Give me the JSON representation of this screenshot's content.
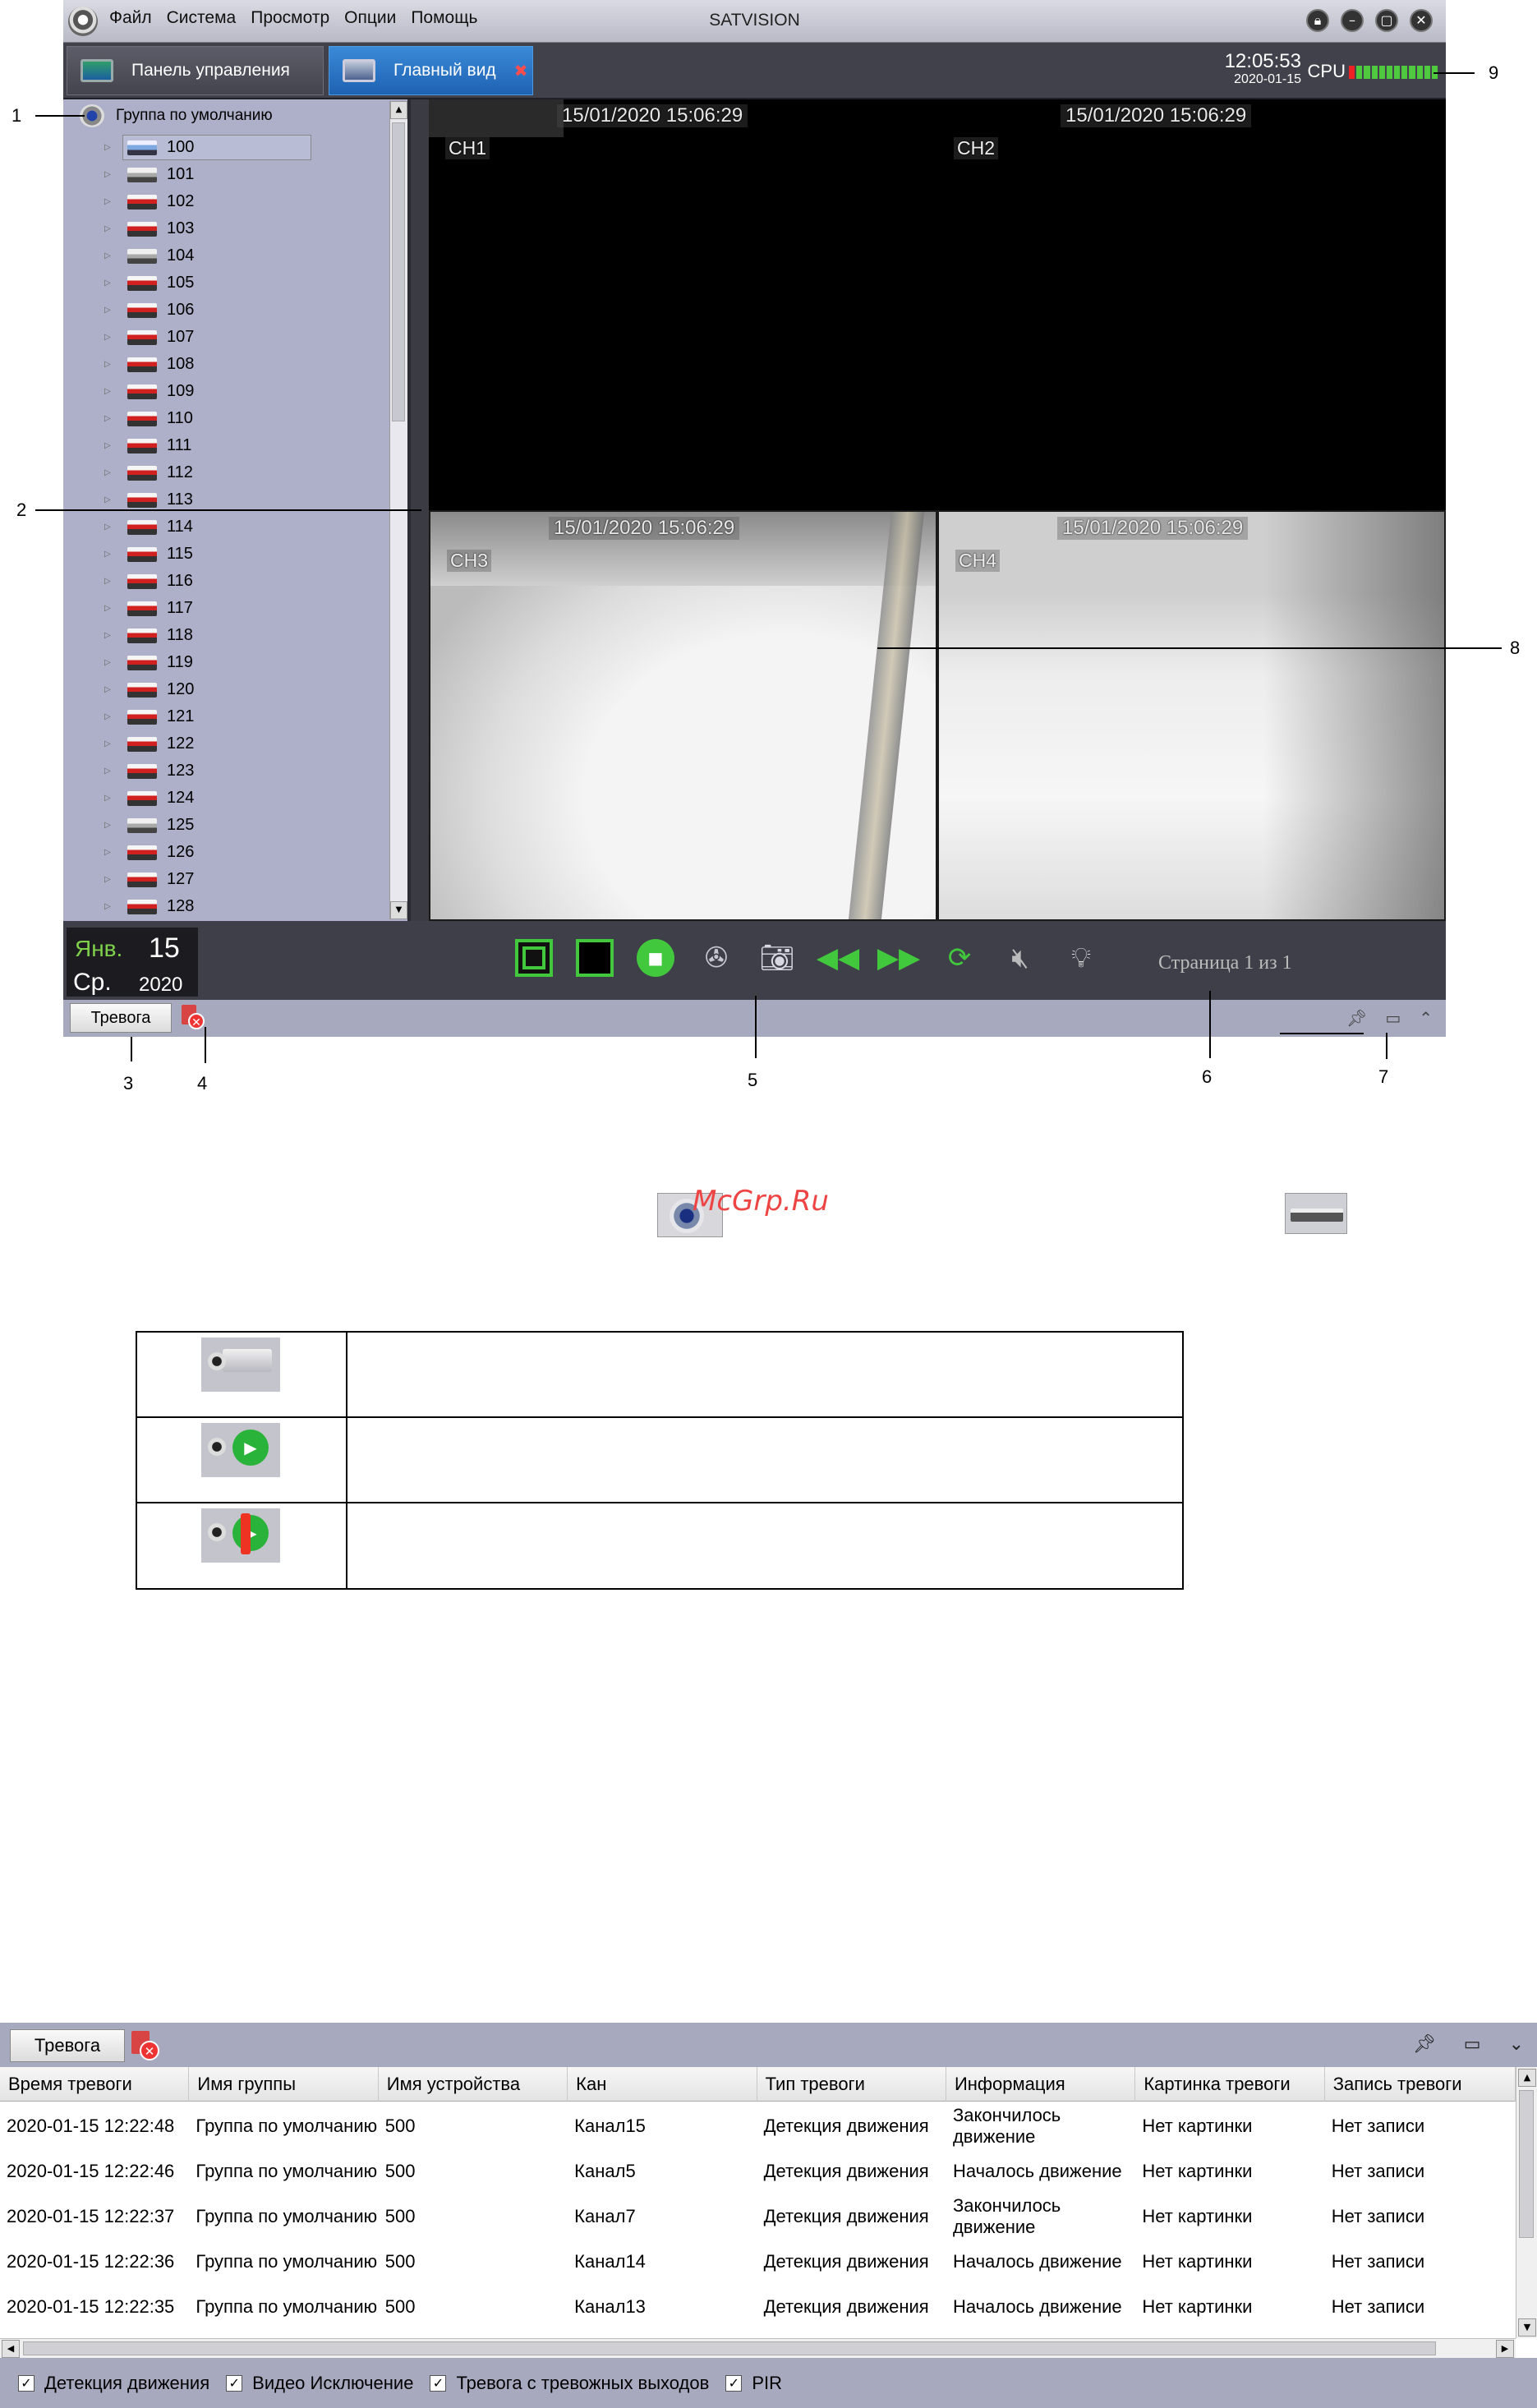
{
  "app": {
    "title": "SATVISION",
    "menu": [
      "Файл",
      "Система",
      "Просмотр",
      "Опции",
      "Помощь"
    ],
    "window_controls": [
      "lock-icon",
      "minimize-icon",
      "maximize-icon",
      "close-icon"
    ]
  },
  "tabs": {
    "dashboard": "Панель управления",
    "main_view": "Главный вид",
    "close_glyph": "✖"
  },
  "status": {
    "time": "12:05:53",
    "date": "2020-01-15",
    "cpu_label": "CPU",
    "cpu_load_fraction": 0.1
  },
  "tree": {
    "group": "Группа по умолчанию",
    "items": [
      {
        "label": "100",
        "state": "online"
      },
      {
        "label": "101",
        "state": "plain"
      },
      {
        "label": "102",
        "state": "ok"
      },
      {
        "label": "103",
        "state": "ok"
      },
      {
        "label": "104",
        "state": "plain"
      },
      {
        "label": "105",
        "state": "ok"
      },
      {
        "label": "106",
        "state": "ok"
      },
      {
        "label": "107",
        "state": "ok"
      },
      {
        "label": "108",
        "state": "ok"
      },
      {
        "label": "109",
        "state": "ok"
      },
      {
        "label": "110",
        "state": "ok"
      },
      {
        "label": "111",
        "state": "ok"
      },
      {
        "label": "112",
        "state": "ok"
      },
      {
        "label": "113",
        "state": "ok"
      },
      {
        "label": "114",
        "state": "ok"
      },
      {
        "label": "115",
        "state": "ok"
      },
      {
        "label": "116",
        "state": "ok"
      },
      {
        "label": "117",
        "state": "ok"
      },
      {
        "label": "118",
        "state": "ok"
      },
      {
        "label": "119",
        "state": "ok"
      },
      {
        "label": "120",
        "state": "ok"
      },
      {
        "label": "121",
        "state": "ok"
      },
      {
        "label": "122",
        "state": "ok"
      },
      {
        "label": "123",
        "state": "ok"
      },
      {
        "label": "124",
        "state": "ok"
      },
      {
        "label": "125",
        "state": "plain"
      },
      {
        "label": "126",
        "state": "ok"
      },
      {
        "label": "127",
        "state": "ok"
      },
      {
        "label": "128",
        "state": "ok"
      }
    ]
  },
  "video": {
    "ch1": {
      "time": "15/01/2020 15:06:29",
      "label": "CH1"
    },
    "ch2": {
      "time": "15/01/2020 15:06:29",
      "label": "CH2"
    },
    "ch3": {
      "time": "15/01/2020 15:06:29",
      "label": "CH3"
    },
    "ch4": {
      "time": "15/01/2020 15:06:29",
      "label": "CH4"
    }
  },
  "calendar": {
    "month": "Янв.",
    "day": "15",
    "weekday": "Ср.",
    "year": "2020"
  },
  "controls": {
    "buttons": [
      "fit-screen-icon",
      "single-screen-icon",
      "stop-all-icon",
      "record-icon",
      "snapshot-icon",
      "previous-page-icon",
      "next-page-icon",
      "cycle-icon",
      "mute-icon",
      "bulb-icon"
    ],
    "page": "Страница 1 из 1"
  },
  "statusbar": {
    "alarm_tab": "Тревога",
    "icons": [
      "pin-icon",
      "restore-icon",
      "collapse-icon"
    ]
  },
  "callouts": [
    "1",
    "2",
    "3",
    "4",
    "5",
    "6",
    "7",
    "8",
    "9"
  ],
  "watermark": "McGrp.Ru",
  "alarm_panel": {
    "tab": "Тревога",
    "columns": [
      "Время тревоги",
      "Имя группы",
      "Имя устройства",
      "Кан",
      "Тип тревоги",
      "Информация",
      "Картинка тревоги",
      "Запись тревоги"
    ],
    "rows": [
      [
        "2020-01-15 12:22:48",
        "Группа по умолчанию",
        "500",
        "Канал15",
        "Детекция движения",
        "Закончилось движение",
        "Нет картинки",
        "Нет записи"
      ],
      [
        "2020-01-15 12:22:46",
        "Группа по умолчанию",
        "500",
        "Канал5",
        "Детекция движения",
        "Началось движение",
        "Нет картинки",
        "Нет записи"
      ],
      [
        "2020-01-15 12:22:37",
        "Группа по умолчанию",
        "500",
        "Канал7",
        "Детекция движения",
        "Закончилось движение",
        "Нет картинки",
        "Нет записи"
      ],
      [
        "2020-01-15 12:22:36",
        "Группа по умолчанию",
        "500",
        "Канал14",
        "Детекция движения",
        "Началось движение",
        "Нет картинки",
        "Нет записи"
      ],
      [
        "2020-01-15 12:22:35",
        "Группа по умолчанию",
        "500",
        "Канал13",
        "Детекция движения",
        "Началось движение",
        "Нет картинки",
        "Нет записи"
      ]
    ],
    "filters": [
      {
        "label": "Детекция движения",
        "checked": true
      },
      {
        "label": "Видео Исключение",
        "checked": true
      },
      {
        "label": "Тревога с тревожных выходов",
        "checked": true
      },
      {
        "label": "PIR",
        "checked": true
      }
    ]
  }
}
